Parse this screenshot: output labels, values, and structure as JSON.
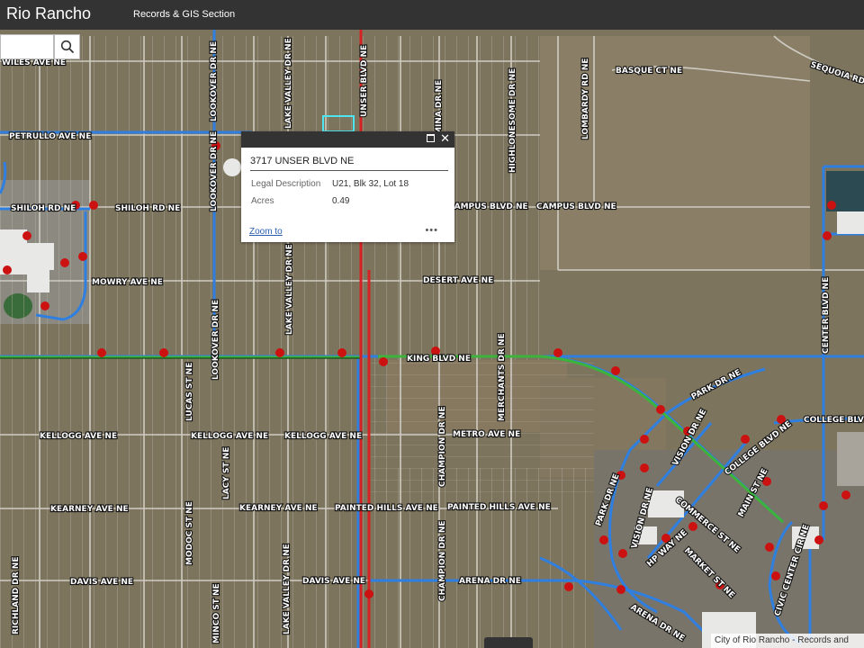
{
  "header": {
    "title": "Rio Rancho",
    "subtitle": "Records & GIS Section"
  },
  "search": {
    "value": "",
    "placeholder": "",
    "icon": "search-icon"
  },
  "popup": {
    "title": "3717 UNSER BLVD NE",
    "fields": [
      {
        "label": "Legal Description",
        "value": "U21, Blk 32, Lot 18"
      },
      {
        "label": "Acres",
        "value": "0.49"
      }
    ],
    "zoom_label": "Zoom to",
    "more_label": "•••"
  },
  "map": {
    "street_labels": {
      "wiles": "WILES AVE NE",
      "basque": "BASQUE CT NE",
      "sequoia": "SEQUOIA RD",
      "petrullo": "PETRULLO AVE NE",
      "shiloh1": "SHILOH RD NE",
      "shiloh2": "SHILOH RD NE",
      "campus1": "CAMPUS BLVD NE",
      "campus2": "CAMPUS BLVD NE",
      "mowry": "MOWRY AVE NE",
      "desert": "DESERT AVE NE",
      "king": "KING BLVD NE",
      "park": "PARK DR NE",
      "college1": "COLLEGE BLVD NE",
      "college2": "COLLEGE BLVD NE",
      "kellogg1": "KELLOGG AVE NE",
      "kellogg2": "KELLOGG AVE NE",
      "kellogg3": "KELLOGG AVE NE",
      "metro": "METRO AVE NE",
      "kearney1": "KEARNEY AVE NE",
      "kearney2": "KEARNEY AVE NE",
      "painted1": "PAINTED HILLS AVE NE",
      "painted2": "PAINTED HILLS AVE NE",
      "davis1": "DAVIS AVE NE",
      "davis2": "DAVIS AVE NE",
      "arena1": "ARENA DR NE",
      "arena2": "ARENA DR NE",
      "unser": "UNSER BLVD NE",
      "lakevalley1": "LAKE VALLEY DR NE",
      "lakevalley2": "LAKE VALLEY DR NE",
      "lakevalley3": "LAKE VALLEY DR NE",
      "lookover1": "LOOKOVER DR NE",
      "lookover2": "LOOKOVER DR NE",
      "lookover3": "LOOKOVER DR NE",
      "lucas": "LUCAS ST NE",
      "lacy": "LACY ST NE",
      "modoc": "MODOC ST NE",
      "minco": "MINCO ST NE",
      "richland": "RICHLAND DR NE",
      "mina": "MINA DR NE",
      "highlonesome": "HIGHLONESOME DR NE",
      "lombardy": "LOMBARDY RD NE",
      "merchants": "MERCHANTS DR NE",
      "champion1": "CHAMPION DR NE",
      "champion2": "CHAMPION DR NE",
      "center": "CENTER BLVD NE",
      "vision1": "VISION DR NE",
      "vision2": "VISION DR NE",
      "vision3": "VISION DR NE",
      "parkdr": "PARK DR NE",
      "commerce": "COMMERCE ST NE",
      "hpway": "HP WAY NE",
      "market": "MARKET ST NE",
      "main": "MAIN ST NE",
      "civic": "CIVIC CENTER CIR NE"
    },
    "colors": {
      "ground": "#7d745e",
      "street_grid": "#c9c5bd",
      "blue_line": "#2f7fe0",
      "red_line": "#d62222",
      "green_line": "#3cb43c",
      "hydrant": "#cc1111",
      "selected_parcel": "#4de6f0"
    }
  },
  "attribution": "City of Rio Rancho - Records and"
}
